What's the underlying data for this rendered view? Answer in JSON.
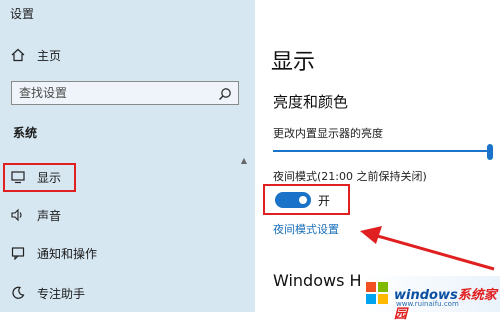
{
  "app": {
    "title": "设置"
  },
  "sidebar": {
    "home_label": "主页",
    "search_placeholder": "查找设置",
    "section_label": "系统",
    "items": [
      {
        "label": "显示",
        "icon": "monitor-icon"
      },
      {
        "label": "声音",
        "icon": "speaker-icon"
      },
      {
        "label": "通知和操作",
        "icon": "notification-icon"
      },
      {
        "label": "专注助手",
        "icon": "moon-icon"
      }
    ]
  },
  "main": {
    "page_title": "显示",
    "section_title": "亮度和颜色",
    "brightness_label": "更改内置显示器的亮度",
    "brightness_value": 1.0,
    "night_mode_label": "夜间模式(21:00 之前保持关闭)",
    "night_mode_state": "开",
    "night_mode_on": true,
    "night_settings_link": "夜间模式设置",
    "windows_heading": "Windows H"
  },
  "watermark": {
    "brand_prefix": "windows",
    "brand_suffix": "系统家园",
    "url": "www.ruinaifu.com"
  },
  "colors": {
    "sidebar_bg": "#d6e7f2",
    "accent": "#1a73c8",
    "annotation_red": "#e02020"
  }
}
